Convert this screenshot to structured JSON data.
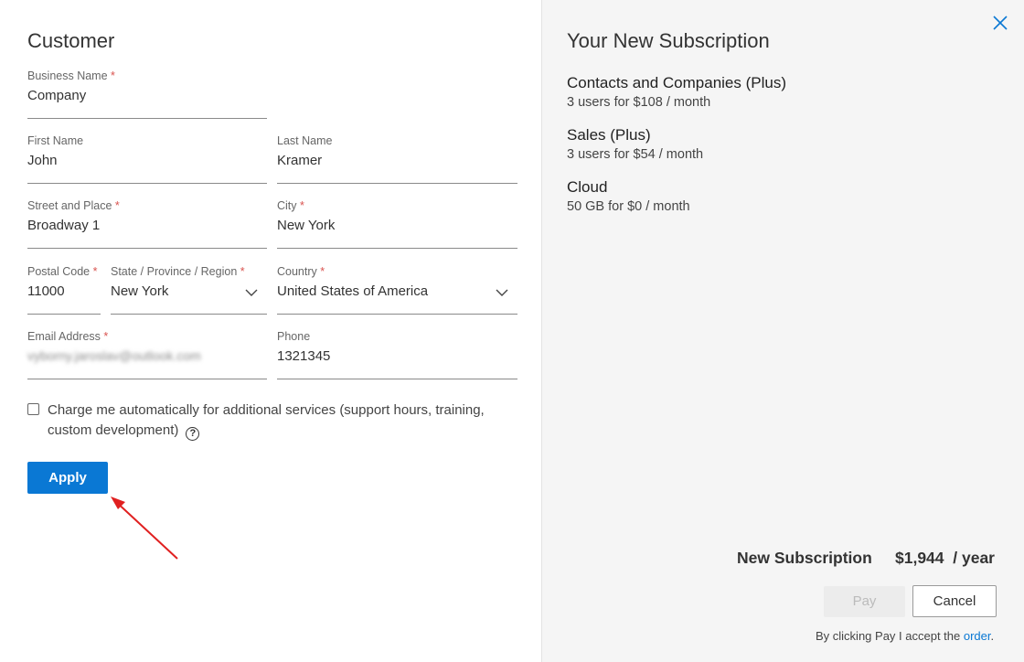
{
  "customer": {
    "title": "Customer",
    "business_name": {
      "label": "Business Name",
      "required": "*",
      "value": "Company"
    },
    "first_name": {
      "label": "First Name",
      "value": "John"
    },
    "last_name": {
      "label": "Last Name",
      "value": "Kramer"
    },
    "street": {
      "label": "Street and Place",
      "required": "*",
      "value": "Broadway 1"
    },
    "city": {
      "label": "City",
      "required": "*",
      "value": "New York"
    },
    "postal_code": {
      "label": "Postal Code",
      "required": "*",
      "value": "11000"
    },
    "state": {
      "label": "State / Province / Region",
      "required": "*",
      "value": "New York"
    },
    "country": {
      "label": "Country",
      "required": "*",
      "value": "United States of America"
    },
    "email": {
      "label": "Email Address",
      "required": "*",
      "value": "vyborny.jaroslav@outlook.com"
    },
    "phone": {
      "label": "Phone",
      "value": "1321345"
    },
    "auto_charge": {
      "label": "Charge me automatically for additional services (support hours, training, custom development)",
      "checked": false,
      "help_icon": "question-circle-icon"
    },
    "apply_label": "Apply"
  },
  "subscription": {
    "title": "Your New Subscription",
    "close_icon": "close-icon",
    "items": [
      {
        "name": "Contacts and Companies (Plus)",
        "detail": "3 users for $108 / month"
      },
      {
        "name": "Sales (Plus)",
        "detail": "3 users for $54 / month"
      },
      {
        "name": "Cloud",
        "detail": "50 GB for $0 / month"
      }
    ],
    "total_label": "New Subscription",
    "total_value": "$1,944  / year",
    "pay_label": "Pay",
    "cancel_label": "Cancel",
    "terms_prefix": "By clicking Pay I accept the",
    "terms_link": "order",
    "terms_suffix": "."
  },
  "colors": {
    "accent": "#0a78d4",
    "required": "#d9534f",
    "annotation_arrow": "#e02020"
  }
}
